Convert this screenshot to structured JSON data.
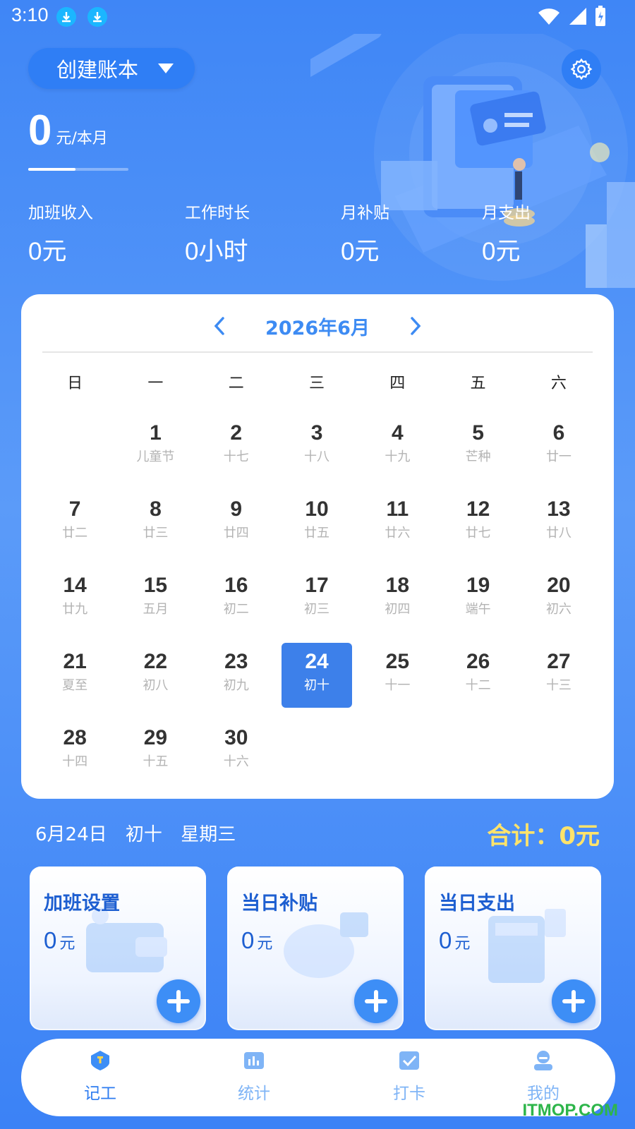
{
  "status_bar": {
    "time": "3:10"
  },
  "header": {
    "ledger_label": "创建账本",
    "amount_value": "0",
    "amount_unit": "元/本月",
    "month_progress": 0.47
  },
  "stats": [
    {
      "title": "加班收入",
      "value": "0元"
    },
    {
      "title": "工作时长",
      "value": "0小时"
    },
    {
      "title": "月补贴",
      "value": "0元"
    },
    {
      "title": "月支出",
      "value": "0元"
    }
  ],
  "calendar": {
    "title": "2026年6月",
    "weekdays": [
      "日",
      "一",
      "二",
      "三",
      "四",
      "五",
      "六"
    ],
    "days": [
      {
        "d": "1",
        "l": "儿童节"
      },
      {
        "d": "2",
        "l": "十七"
      },
      {
        "d": "3",
        "l": "十八"
      },
      {
        "d": "4",
        "l": "十九"
      },
      {
        "d": "5",
        "l": "芒种"
      },
      {
        "d": "6",
        "l": "廿一"
      },
      {
        "d": "7",
        "l": "廿二"
      },
      {
        "d": "8",
        "l": "廿三"
      },
      {
        "d": "9",
        "l": "廿四"
      },
      {
        "d": "10",
        "l": "廿五"
      },
      {
        "d": "11",
        "l": "廿六"
      },
      {
        "d": "12",
        "l": "廿七"
      },
      {
        "d": "13",
        "l": "廿八"
      },
      {
        "d": "14",
        "l": "廿九"
      },
      {
        "d": "15",
        "l": "五月"
      },
      {
        "d": "16",
        "l": "初二"
      },
      {
        "d": "17",
        "l": "初三"
      },
      {
        "d": "18",
        "l": "初四"
      },
      {
        "d": "19",
        "l": "端午"
      },
      {
        "d": "20",
        "l": "初六"
      },
      {
        "d": "21",
        "l": "夏至"
      },
      {
        "d": "22",
        "l": "初八"
      },
      {
        "d": "23",
        "l": "初九"
      },
      {
        "d": "24",
        "l": "初十"
      },
      {
        "d": "25",
        "l": "十一"
      },
      {
        "d": "26",
        "l": "十二"
      },
      {
        "d": "27",
        "l": "十三"
      },
      {
        "d": "28",
        "l": "十四"
      },
      {
        "d": "29",
        "l": "十五"
      },
      {
        "d": "30",
        "l": "十六"
      }
    ],
    "first_weekday": 1,
    "selected": "24"
  },
  "selected_date": {
    "date": "6月24日",
    "lunar": "初十",
    "weekday": "星期三",
    "total": "合计：0元"
  },
  "cards": [
    {
      "title": "加班设置",
      "value": "0",
      "unit": "元"
    },
    {
      "title": "当日补贴",
      "value": "0",
      "unit": "元"
    },
    {
      "title": "当日支出",
      "value": "0",
      "unit": "元"
    }
  ],
  "nav": [
    {
      "label": "记工"
    },
    {
      "label": "统计"
    },
    {
      "label": "打卡"
    },
    {
      "label": "我的"
    }
  ],
  "watermark": "ITMOP.COM",
  "colors": {
    "primary": "#3d80ea",
    "accent": "#ffe36b",
    "watermark": "#2db54a"
  }
}
